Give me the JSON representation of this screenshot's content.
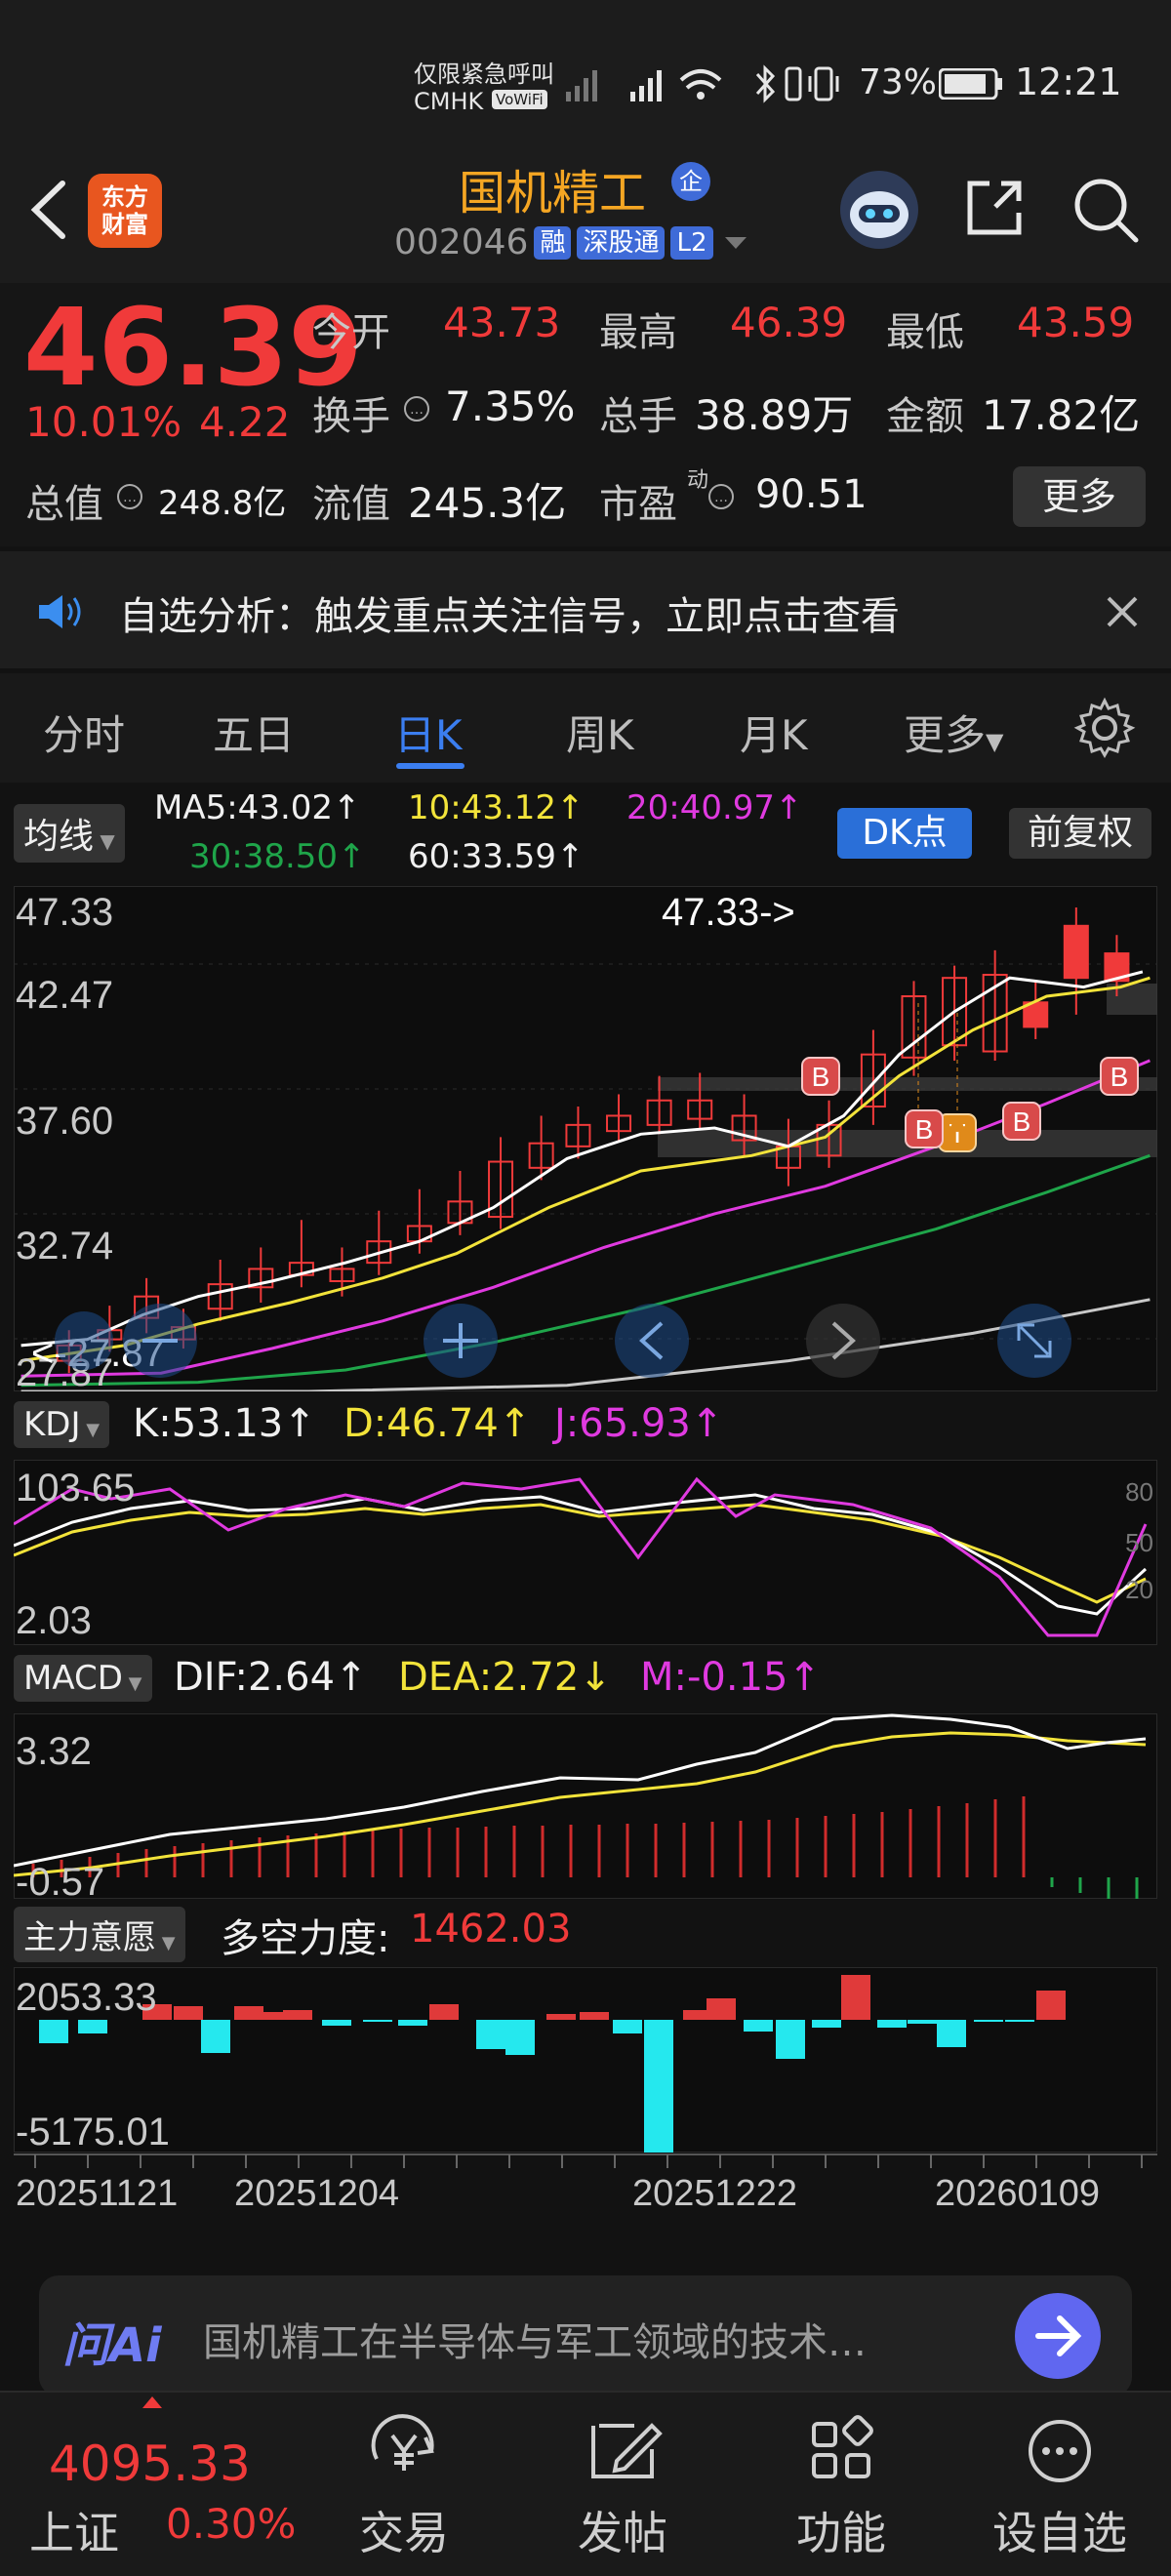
{
  "status": {
    "emergency": "仅限紧急呼叫",
    "carrier": "CMHK",
    "vowifi": "VoWiFi",
    "battery": "73%",
    "time": "12:21"
  },
  "header": {
    "logo_line1": "东方",
    "logo_line2": "财富",
    "stock_name": "国机精工",
    "badge": "企",
    "code": "002046",
    "tags": [
      "融",
      "深股通",
      "L2"
    ]
  },
  "quote": {
    "price": "46.39",
    "change_pct": "10.01%",
    "change_abs": "4.22",
    "open_label": "今开",
    "open": "43.73",
    "high_label": "最高",
    "high": "46.39",
    "low_label": "最低",
    "low": "43.59",
    "turnover_label": "换手",
    "turnover": "7.35%",
    "volume_label": "总手",
    "volume": "38.89万",
    "amount_label": "金额",
    "amount": "17.82亿",
    "mktcap_label": "总值",
    "mktcap": "248.8亿",
    "float_label": "流值",
    "float": "245.3亿",
    "pe_label": "市盈",
    "pe_sup": "动",
    "pe": "90.51",
    "more_btn": "更多"
  },
  "notice": {
    "text": "自选分析：触发重点关注信号，立即点击查看"
  },
  "tabs": [
    "分时",
    "五日",
    "日K",
    "周K",
    "月K",
    "更多"
  ],
  "active_tab": "日K",
  "ma_bar": {
    "selector": "均线",
    "ma5": "MA5:43.02",
    "ma10": "10:43.12",
    "ma20": "20:40.97",
    "ma30": "30:38.50",
    "ma60": "60:33.59",
    "dk_btn": "DK点",
    "restore_btn": "前复权"
  },
  "kline": {
    "y_ticks": [
      "47.33",
      "42.47",
      "37.60",
      "32.74",
      "27.87"
    ],
    "max_label": "47.33->",
    "min_label": "<-27.87",
    "signals": [
      "B",
      "B",
      "B",
      "T",
      "B",
      "B"
    ],
    "colors": {
      "up": "#f03a3a",
      "ma5": "#ffffff",
      "ma10": "#f2e33a",
      "ma20": "#e03ae0",
      "ma30": "#1fa54a",
      "ma60": "#c8c8c8"
    }
  },
  "kdj": {
    "selector": "KDJ",
    "k": "K:53.13",
    "d": "D:46.74",
    "j": "J:65.93",
    "y_top": "103.65",
    "y_bottom": "2.03",
    "levels": [
      "80",
      "50",
      "20"
    ]
  },
  "macd": {
    "selector": "MACD",
    "dif": "DIF:2.64",
    "dea": "DEA:2.72",
    "m": "M:-0.15",
    "y_top": "3.32",
    "y_bottom": "-0.57"
  },
  "force": {
    "selector": "主力意愿",
    "label": "多空力度:",
    "value": "1462.03",
    "y_top": "2053.33",
    "y_bottom": "-5175.01"
  },
  "dates": [
    "20251121",
    "20251204",
    "20251222",
    "20260109"
  ],
  "ask": {
    "logo": "问Ai",
    "text": "国机精工在半导体与军工领域的技术…"
  },
  "bottom_nav": {
    "index_value": "4095.33",
    "index_name": "上证",
    "index_change": "0.30%",
    "items": [
      "交易",
      "发帖",
      "功能",
      "设自选"
    ]
  }
}
